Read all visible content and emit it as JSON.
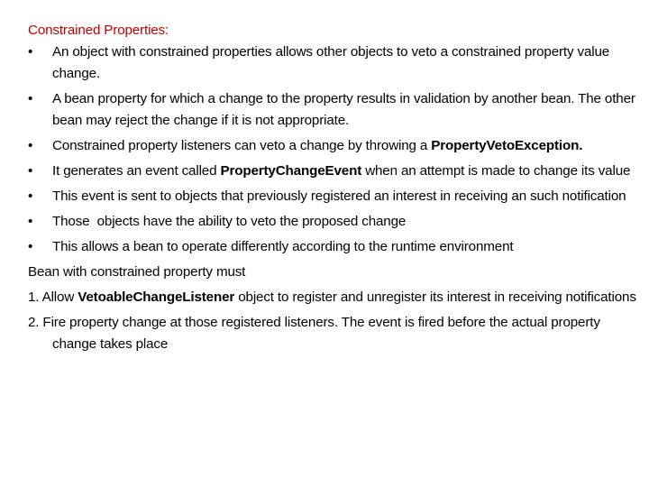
{
  "title": "Constrained Properties:",
  "bullet_glyph": "•",
  "bullets": [
    {
      "text": "An object with constrained properties allows other objects to veto a constrained property value change."
    },
    {
      "text": "A bean property for which a change to the property results in validation by another bean. The other bean may reject the change if it is not appropriate."
    },
    {
      "pre": "Constrained property listeners can veto a change by throwing a ",
      "bold": "PropertyVetoException.",
      "post": ""
    },
    {
      "pre": "It generates an event called ",
      "bold": "PropertyChangeEvent",
      "post": " when an attempt is made to change its value"
    },
    {
      "text": "This event is sent to objects that previously registered an interest in receiving an such notification"
    },
    {
      "text": "Those  objects have the ability to veto the proposed change"
    },
    {
      "text": "This allows a bean to operate differently according to the runtime environment"
    }
  ],
  "subheading": "Bean with constrained property must",
  "steps": [
    {
      "pre": "1. Allow ",
      "bold": "VetoableChangeListener",
      "post": " object to register and unregister its interest in receiving notifications"
    },
    {
      "text": "2. Fire property change at those registered listeners. The event is fired before the actual property change takes place"
    }
  ]
}
